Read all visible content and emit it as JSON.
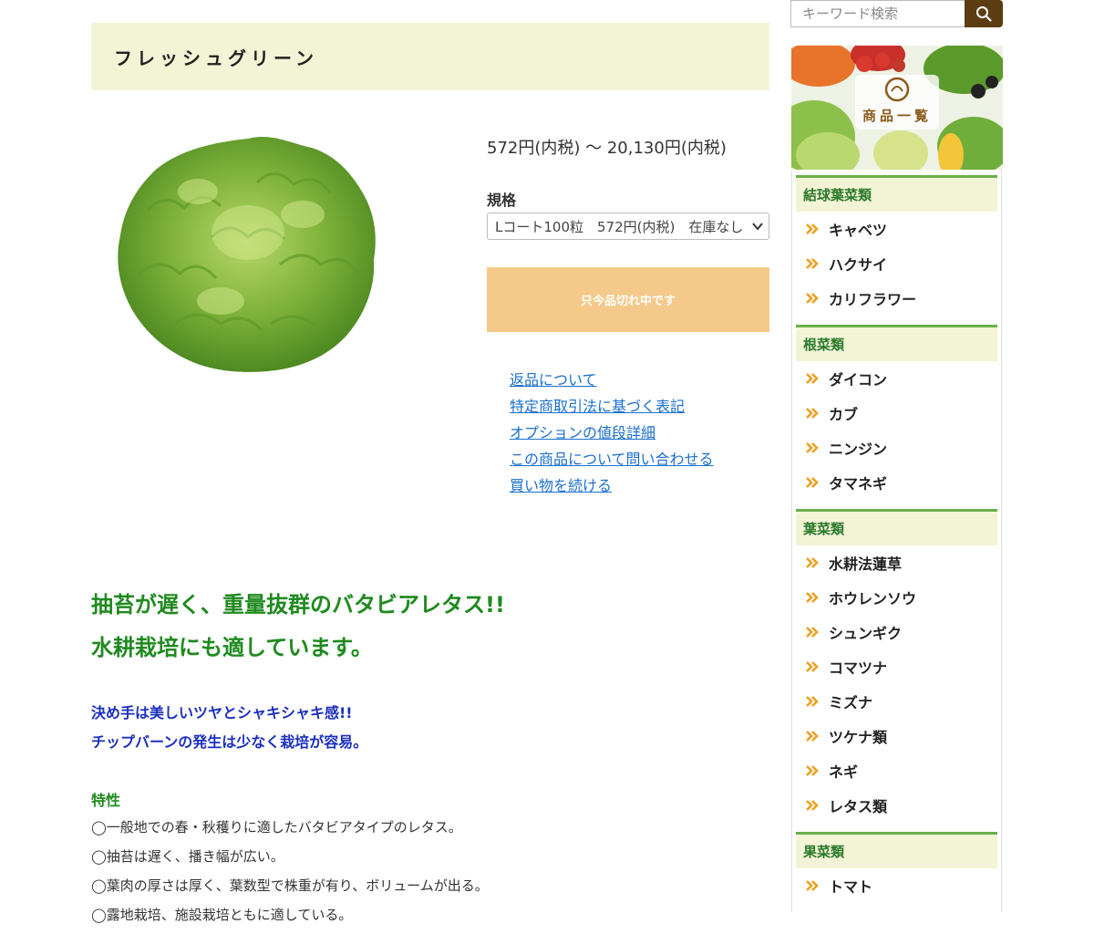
{
  "product": {
    "title": "フレッシュグリーン",
    "price": "572円(内税) 〜 20,130円(内税)",
    "spec_label": "規格",
    "spec_selected": "Lコート100粒　572円(内税)　在庫なし",
    "soldout_label": "只今品切れ中です",
    "links": [
      "返品について",
      "特定商取引法に基づく表記",
      "オプションの値段詳細",
      "この商品について問い合わせる",
      "買い物を続ける"
    ]
  },
  "description": {
    "headline_1": "抽苔が遅く、重量抜群のバタビアレタス!!",
    "headline_2": "水耕栽培にも適しています。",
    "sub_1": "決め手は美しいツヤとシャキシャキ感!!",
    "sub_2": "チップバーンの発生は少なく栽培が容易。",
    "feature_title": "特性",
    "features": [
      "◯一般地での春・秋穫りに適したバタビアタイプのレタス。",
      "◯抽苔は遅く、播き幅が広い。",
      "◯葉肉の厚さは厚く、葉数型で株重が有り、ボリュームが出る。",
      "◯露地栽培、施設栽培ともに適している。"
    ]
  },
  "search": {
    "placeholder": "キーワード検索"
  },
  "banner": {
    "text": "商品一覧"
  },
  "sidebar": {
    "categories": [
      {
        "name": "結球葉菜類",
        "items": [
          "キャベツ",
          "ハクサイ",
          "カリフラワー"
        ]
      },
      {
        "name": "根菜類",
        "items": [
          "ダイコン",
          "カブ",
          "ニンジン",
          "タマネギ"
        ]
      },
      {
        "name": "葉菜類",
        "items": [
          "水耕法蓮草",
          "ホウレンソウ",
          "シュンギク",
          "コマツナ",
          "ミズナ",
          "ツケナ類",
          "ネギ",
          "レタス類"
        ]
      },
      {
        "name": "果菜類",
        "items": [
          "トマト"
        ]
      }
    ]
  },
  "colors": {
    "title_bg": "#f3f3d6",
    "soldout_bg": "#f5c98a",
    "link": "#1a6fcf",
    "headline_green": "#1f8a1f",
    "sub_blue": "#1a2fbf",
    "search_button": "#5c3d12",
    "category_border": "#6ab04c",
    "arrow_orange": "#f0a020"
  }
}
